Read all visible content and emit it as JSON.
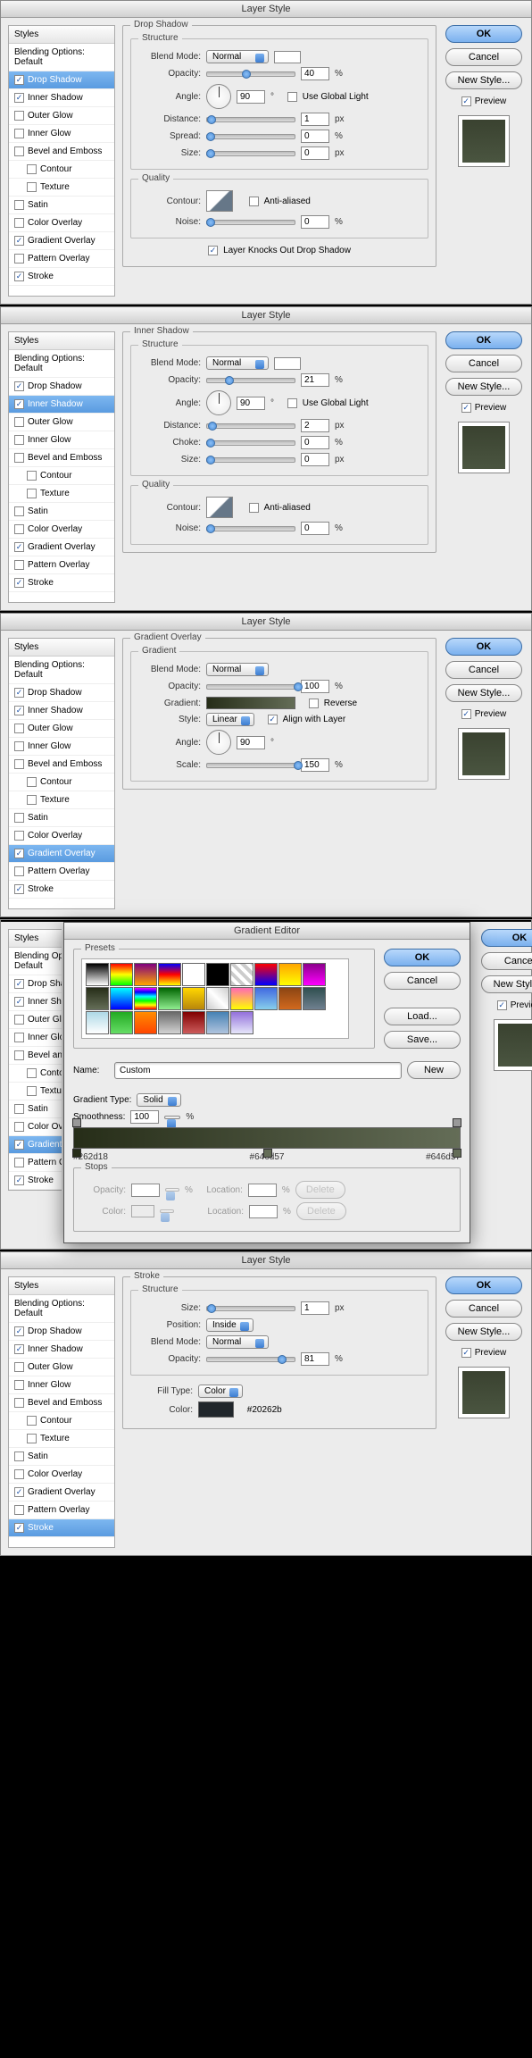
{
  "dialogs": [
    {
      "title": "Layer Style",
      "section": "Drop Shadow",
      "selected": "Drop Shadow",
      "structure": {
        "blendMode": "Normal",
        "opacity": "40",
        "angle": "90",
        "useGlobal": false,
        "distance": "1",
        "spread": "0",
        "size": "0"
      },
      "quality": {
        "antialiased": false,
        "noise": "0"
      },
      "footer": "Layer Knocks Out Drop Shadow"
    },
    {
      "title": "Layer Style",
      "section": "Inner Shadow",
      "selected": "Inner Shadow",
      "structure": {
        "blendMode": "Normal",
        "opacity": "21",
        "angle": "90",
        "useGlobal": false,
        "distance": "2",
        "choke": "0",
        "size": "0"
      },
      "quality": {
        "antialiased": false,
        "noise": "0"
      }
    },
    {
      "title": "Layer Style",
      "section": "Gradient Overlay",
      "selected": "Gradient Overlay",
      "gradient": {
        "blendMode": "Normal",
        "opacity": "100",
        "reverse": false,
        "style": "Linear",
        "alignWithLayer": true,
        "angle": "90",
        "scale": "150"
      }
    },
    {
      "title": "Layer Style",
      "section": "Stroke",
      "selected": "Stroke",
      "stroke": {
        "size": "1",
        "position": "Inside",
        "blendMode": "Normal",
        "opacity": "81",
        "fillType": "Color",
        "color": "#20262b"
      }
    }
  ],
  "styleList": [
    "Drop Shadow",
    "Inner Shadow",
    "Outer Glow",
    "Inner Glow",
    "Bevel and Emboss",
    "Contour",
    "Texture",
    "Satin",
    "Color Overlay",
    "Gradient Overlay",
    "Pattern Overlay",
    "Stroke"
  ],
  "checked": [
    "Drop Shadow",
    "Inner Shadow",
    "Gradient Overlay",
    "Stroke"
  ],
  "subs": [
    "Contour",
    "Texture"
  ],
  "buttons": {
    "ok": "OK",
    "cancel": "Cancel",
    "newStyle": "New Style...",
    "preview": "Preview"
  },
  "labels": {
    "styles": "Styles",
    "blendOpts": "Blending Options: Default",
    "structure": "Structure",
    "quality": "Quality",
    "gradient": "Gradient",
    "blendMode": "Blend Mode:",
    "opacity": "Opacity:",
    "angle": "Angle:",
    "useGlobal": "Use Global Light",
    "distance": "Distance:",
    "spread": "Spread:",
    "size": "Size:",
    "choke": "Choke:",
    "contour": "Contour:",
    "antialiased": "Anti-aliased",
    "noise": "Noise:",
    "gradientL": "Gradient:",
    "reverse": "Reverse",
    "style": "Style:",
    "align": "Align with Layer",
    "scale": "Scale:",
    "position": "Position:",
    "fillType": "Fill Type:",
    "color": "Color:",
    "px": "px",
    "pct": "%",
    "deg": "°"
  },
  "gradEditor": {
    "title": "Gradient Editor",
    "presets": "Presets",
    "name": "Name:",
    "nameVal": "Custom",
    "new": "New",
    "load": "Load...",
    "save": "Save...",
    "gradType": "Gradient Type:",
    "gradTypeVal": "Solid",
    "smoothness": "Smoothness:",
    "smoothVal": "100",
    "stops": "Stops",
    "opacityL": "Opacity:",
    "location": "Location:",
    "colorL": "Color:",
    "delete": "Delete",
    "colors": [
      "#262d18",
      "#646d57",
      "#646d57"
    ]
  }
}
